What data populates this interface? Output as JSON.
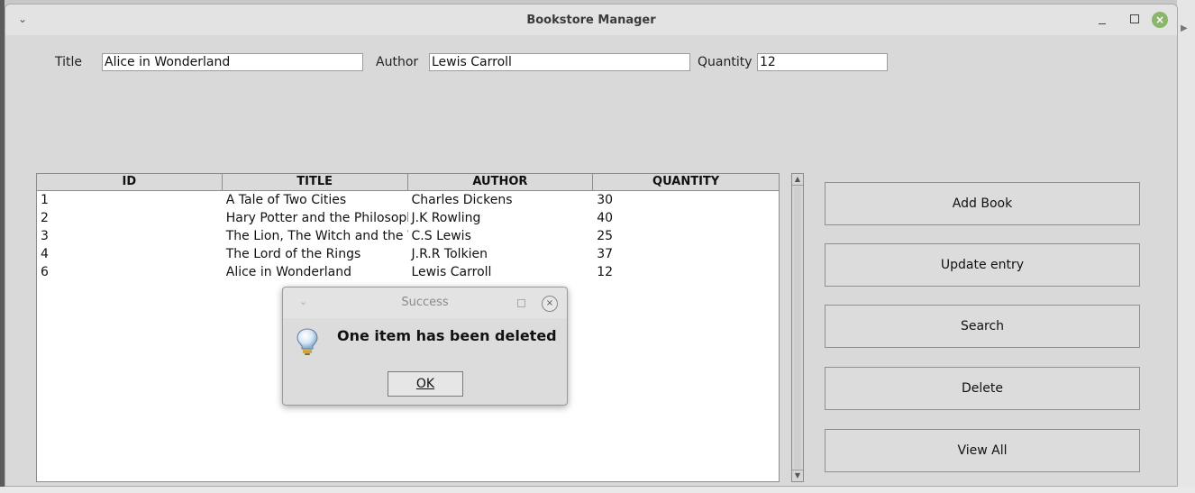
{
  "window": {
    "title": "Bookstore Manager"
  },
  "form": {
    "title_label": "Title",
    "title_value": "Alice in Wonderland",
    "author_label": "Author",
    "author_value": "Lewis Carroll",
    "quantity_label": "Quantity",
    "quantity_value": "12"
  },
  "table": {
    "headers": [
      "ID",
      "TITLE",
      "AUTHOR",
      "QUANTITY"
    ],
    "rows": [
      [
        "1",
        "A Tale of Two Cities",
        "Charles Dickens",
        "30"
      ],
      [
        "2",
        "Hary Potter and the Philosophe",
        "J.K Rowling",
        "40"
      ],
      [
        "3",
        "The Lion, The Witch and the W",
        "C.S Lewis",
        "25"
      ],
      [
        "4",
        "The Lord of the Rings",
        "J.R.R Tolkien",
        "37"
      ],
      [
        "6",
        "Alice in Wonderland",
        "Lewis Carroll",
        "12"
      ]
    ]
  },
  "buttons": {
    "add": "Add Book",
    "update": "Update entry",
    "search": "Search",
    "delete": "Delete",
    "view_all": "View All"
  },
  "dialog": {
    "title": "Success",
    "message": "One item has been deleted",
    "ok_label": "OK",
    "icon": "lightbulb-icon"
  },
  "colors": {
    "window_bg": "#d9d9d9",
    "close_button": "#8ab56a"
  }
}
